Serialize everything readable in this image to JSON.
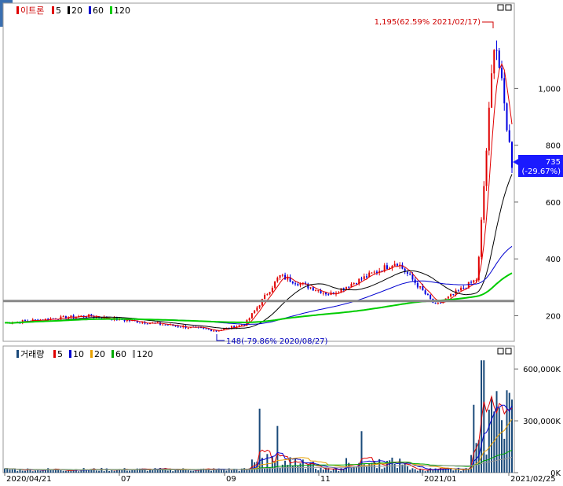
{
  "side_tab": {
    "label": "호"
  },
  "price_panel": {
    "legend_name": "이트론",
    "legend": [
      {
        "label": "5",
        "color": "#e00000"
      },
      {
        "label": "20",
        "color": "#000000"
      },
      {
        "label": "60",
        "color": "#0000d0"
      },
      {
        "label": "120",
        "color": "#00cc00"
      }
    ],
    "y_ticks": [
      "1,000",
      "800",
      "600",
      "400",
      "200"
    ],
    "max_note": "1,195(62.59% 2021/02/17)",
    "min_note": "148(-79.86% 2020/08/27)",
    "current_price": "735",
    "current_change": "(-29.67%)",
    "horizontal_line_value": 252
  },
  "volume_panel": {
    "legend_name": "거래량",
    "legend": [
      {
        "label": "5",
        "color": "#e00000"
      },
      {
        "label": "10",
        "color": "#0000d0"
      },
      {
        "label": "20",
        "color": "#e8a000"
      },
      {
        "label": "60",
        "color": "#00aa00"
      },
      {
        "label": "120",
        "color": "#999999"
      }
    ],
    "y_ticks": [
      "600,000K",
      "300,000K",
      "0K"
    ]
  },
  "x_ticks": [
    "2020/04/21",
    "07",
    "09",
    "11",
    "2021/01",
    "2021/02/25"
  ],
  "chart_data": [
    {
      "type": "candlestick",
      "title": "이트론",
      "series_ma": [
        "5",
        "20",
        "60",
        "120"
      ],
      "ylim": [
        110,
        1300
      ],
      "key_points": [
        {
          "date": "2020/04/21",
          "close": 175
        },
        {
          "date": "2020/06",
          "close": 200
        },
        {
          "date": "2020/08/27",
          "close": 148,
          "note": "low"
        },
        {
          "date": "2020/09",
          "close": 170
        },
        {
          "date": "2020/10",
          "close": 340
        },
        {
          "date": "2020/11",
          "close": 275
        },
        {
          "date": "2020/12",
          "close": 390
        },
        {
          "date": "2021/01",
          "close": 235
        },
        {
          "date": "2021/02/01",
          "close": 330
        },
        {
          "date": "2021/02/17",
          "close": 1195,
          "note": "high"
        },
        {
          "date": "2021/02/25",
          "close": 735
        }
      ],
      "yticks": [
        200,
        400,
        600,
        800,
        1000
      ]
    },
    {
      "type": "bar",
      "title": "거래량",
      "unit": "K",
      "ylim": [
        0,
        660000
      ],
      "yticks": [
        0,
        300000,
        600000
      ],
      "peaks": [
        {
          "date": "2020/09",
          "value": 370000
        },
        {
          "date": "2020/10",
          "value": 270000
        },
        {
          "date": "2020/12",
          "value": 240000
        },
        {
          "date": "2021/02",
          "value": 650000
        }
      ]
    }
  ]
}
